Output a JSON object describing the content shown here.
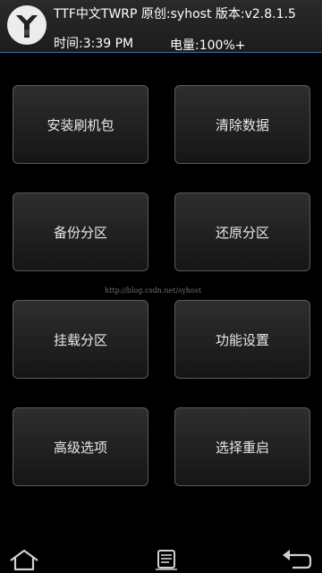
{
  "header": {
    "title": "TTF中文TWRP 原创:syhost 版本:v2.8.1.5",
    "time": "时间:3:39 PM",
    "battery": "电量:100%+",
    "logo_icon": "teamwin-logo-icon",
    "accent_color": "#3b6fa3"
  },
  "menu": {
    "install": "安装刷机包",
    "wipe": "清除数据",
    "backup": "备份分区",
    "restore": "还原分区",
    "mount": "挂载分区",
    "settings": "功能设置",
    "advanced": "高级选项",
    "reboot": "选择重启"
  },
  "watermark": "http://blog.csdn.net/syhost",
  "nav": {
    "home_icon": "home-icon",
    "console_icon": "console-icon",
    "back_icon": "back-icon"
  }
}
